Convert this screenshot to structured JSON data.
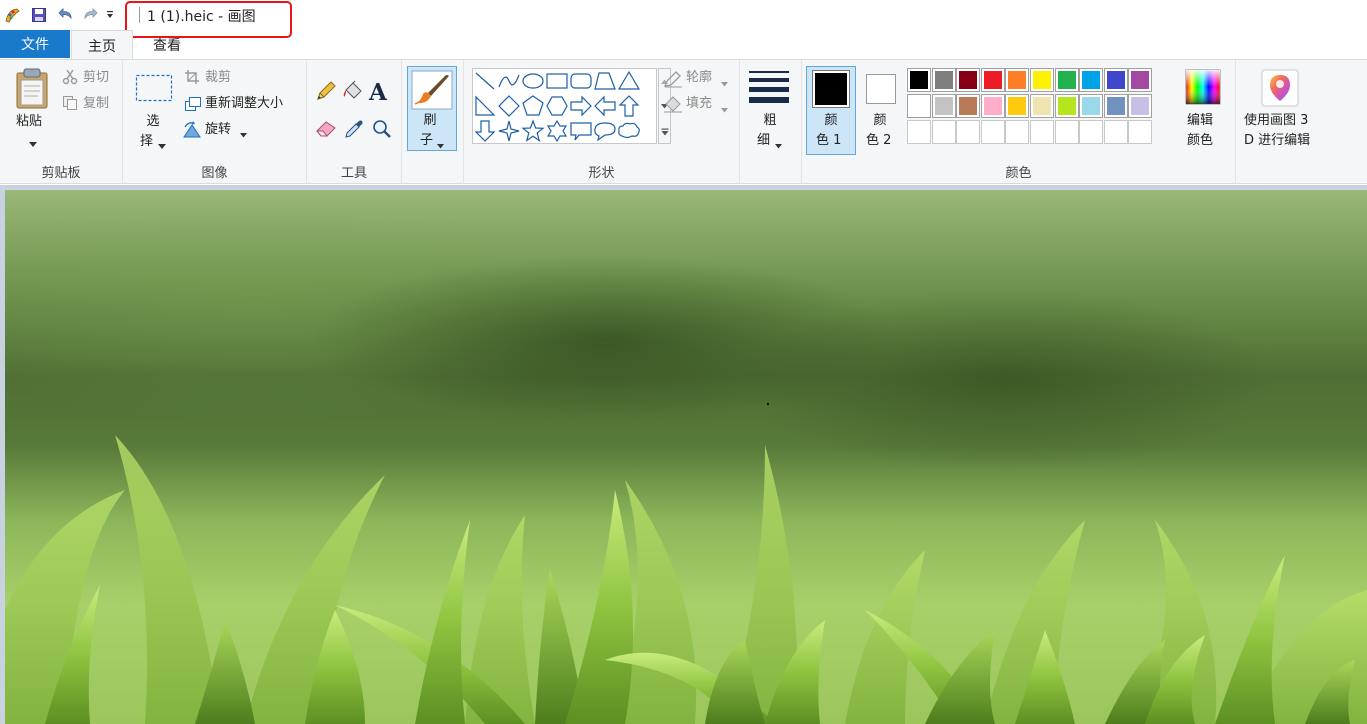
{
  "window": {
    "title": "1 (1).heic - 画图"
  },
  "quick_access": {
    "icons": [
      "paint-app-icon",
      "save-icon",
      "undo-icon",
      "redo-icon",
      "customize-dropdown-icon"
    ]
  },
  "tabs": {
    "file": "文件",
    "home": "主页",
    "view": "查看"
  },
  "groups": {
    "clipboard": {
      "label": "剪贴板",
      "paste": "粘贴",
      "cut": "剪切",
      "copy": "复制"
    },
    "image": {
      "label": "图像",
      "select_line1": "选",
      "select_line2": "择",
      "crop": "裁剪",
      "resize": "重新调整大小",
      "rotate": "旋转"
    },
    "tools": {
      "label": "工具",
      "icons": [
        "pencil-icon",
        "fill-bucket-icon",
        "text-icon",
        "eraser-icon",
        "color-picker-icon",
        "magnifier-icon"
      ],
      "text_glyph": "A"
    },
    "brushes": {
      "line1": "刷",
      "line2": "子"
    },
    "shapes": {
      "label": "形状",
      "outline": "轮廓",
      "fill": "填充"
    },
    "size": {
      "line1": "粗",
      "line2": "细"
    },
    "colors": {
      "label": "颜色",
      "color1_line1": "颜",
      "color1_line2": "色 1",
      "color2_line1": "颜",
      "color2_line2": "色 2",
      "color1_value": "#000000",
      "color2_value": "#ffffff",
      "edit_line1": "编辑",
      "edit_line2": "颜色",
      "palette_row1": [
        "#000000",
        "#7f7f7f",
        "#880015",
        "#ed1c24",
        "#ff7f27",
        "#fff200",
        "#22b14c",
        "#00a2e8",
        "#3f48cc",
        "#a349a4"
      ],
      "palette_row2": [
        "#ffffff",
        "#c3c3c3",
        "#b97a57",
        "#ffaec9",
        "#ffc90e",
        "#efe4b0",
        "#b5e61d",
        "#99d9ea",
        "#7092be",
        "#c8bfe7"
      ]
    },
    "paint3d": {
      "line1": "使用画图 3",
      "line2": "D 进行编辑"
    }
  }
}
